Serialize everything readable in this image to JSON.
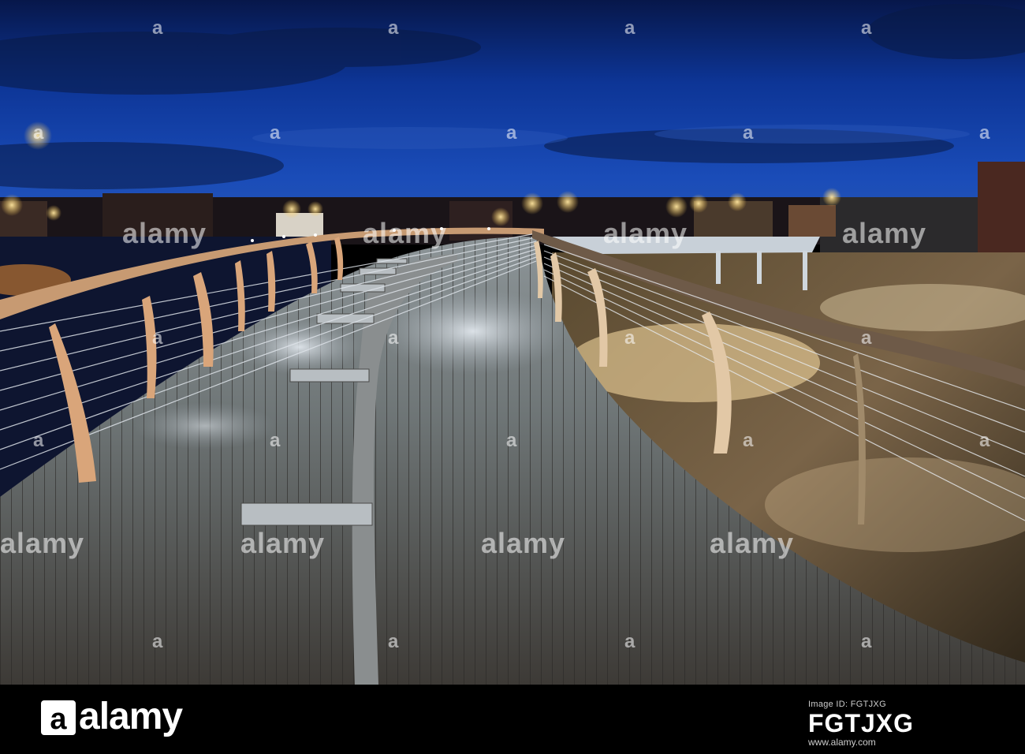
{
  "watermark": {
    "brand": "alamy",
    "brand_small": "a"
  },
  "footer": {
    "brand": "alamy",
    "image_id_label": "Image ID: FGTJXG",
    "image_id": "FGTJXG",
    "url": "www.alamy.com"
  },
  "colors": {
    "sky_top": "#0a1f5c",
    "sky_mid": "#1242a8",
    "sky_low": "#1a4bb8",
    "deck": "#6b7070",
    "rail_wood": "#d9a57a",
    "lamp": "#ffcc55"
  }
}
